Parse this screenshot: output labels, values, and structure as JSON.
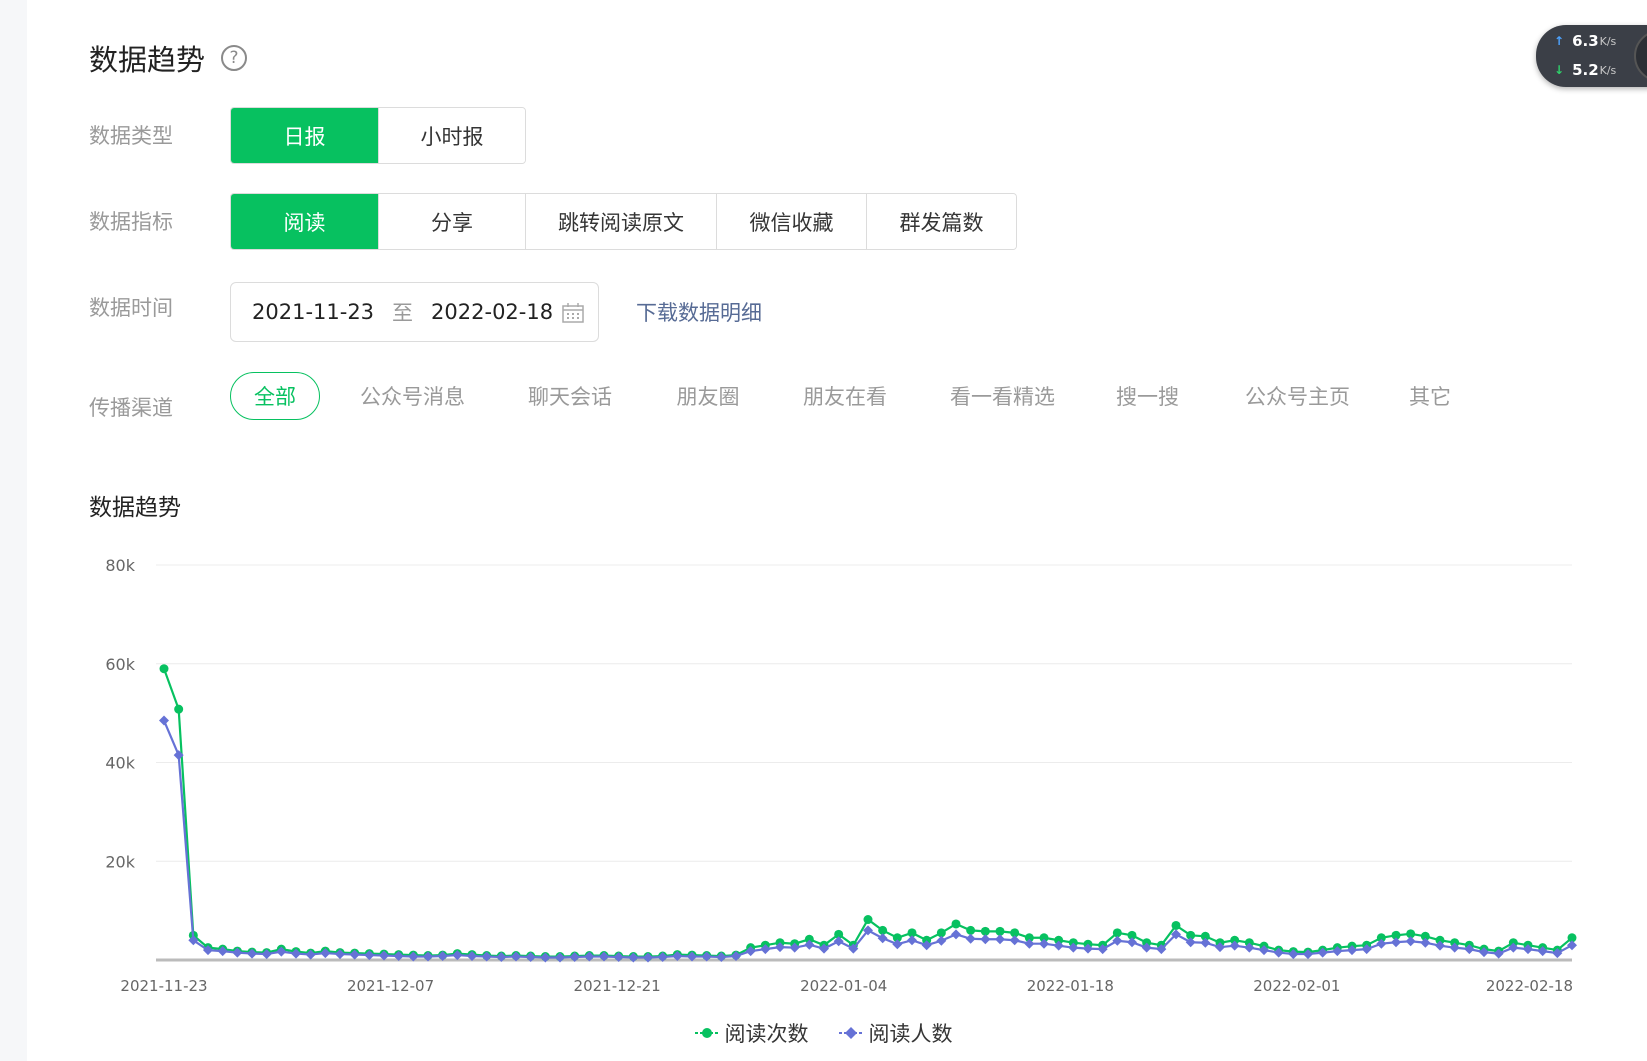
{
  "header": {
    "title": "数据趋势",
    "help_icon": "question-circle-icon"
  },
  "rows": {
    "data_type": {
      "label": "数据类型",
      "options": [
        "日报",
        "小时报"
      ],
      "active": 0
    },
    "data_metric": {
      "label": "数据指标",
      "options": [
        "阅读",
        "分享",
        "跳转阅读原文",
        "微信收藏",
        "群发篇数"
      ],
      "active": 0
    },
    "data_time": {
      "label": "数据时间",
      "start": "2021-11-23",
      "separator": "至",
      "end": "2022-02-18",
      "download": "下载数据明细"
    },
    "channel": {
      "label": "传播渠道",
      "options": [
        "全部",
        "公众号消息",
        "聊天会话",
        "朋友圈",
        "朋友在看",
        "看一看精选",
        "搜一搜",
        "公众号主页",
        "其它"
      ],
      "active": 0
    }
  },
  "speed_widget": {
    "up": "6.3",
    "up_unit": "K/s",
    "down": "5.2",
    "down_unit": "K/s",
    "badge": "5"
  },
  "chart_data": {
    "type": "line",
    "title": "数据趋势",
    "xlabel": "",
    "ylabel": "",
    "ylim": [
      0,
      80000
    ],
    "y_ticks": [
      "80k",
      "60k",
      "40k",
      "20k"
    ],
    "x_tick_labels": [
      "2021-11-23",
      "2021-12-07",
      "2021-12-21",
      "2022-01-04",
      "2022-01-18",
      "2022-02-01",
      "2022-02-18"
    ],
    "x_start": "2021-11-23",
    "x_end": "2022-02-18",
    "colors": {
      "reads": "#07c160",
      "readers": "#6672d6"
    },
    "series": [
      {
        "name": "阅读次数",
        "values": [
          59000,
          50800,
          5000,
          2500,
          2200,
          1800,
          1600,
          1500,
          2200,
          1700,
          1400,
          1800,
          1500,
          1400,
          1300,
          1200,
          1100,
          1000,
          900,
          1000,
          1300,
          1100,
          900,
          800,
          900,
          800,
          700,
          700,
          800,
          900,
          900,
          800,
          700,
          700,
          800,
          1100,
          1000,
          900,
          800,
          1000,
          2500,
          3000,
          3500,
          3300,
          4200,
          3000,
          5200,
          3000,
          8200,
          6000,
          4500,
          5500,
          4000,
          5500,
          7300,
          6000,
          5800,
          5800,
          5500,
          4500,
          4500,
          4000,
          3500,
          3200,
          3000,
          5500,
          5000,
          3500,
          3000,
          7000,
          5000,
          4800,
          3500,
          4000,
          3500,
          2800,
          2000,
          1700,
          1600,
          2000,
          2500,
          2800,
          3000,
          4500,
          5000,
          5300,
          4800,
          4000,
          3500,
          3000,
          2200,
          1800,
          3500,
          3000,
          2500,
          2000,
          4500
        ]
      },
      {
        "name": "阅读人数",
        "values": [
          48500,
          41500,
          4000,
          2000,
          1800,
          1500,
          1300,
          1200,
          1700,
          1300,
          1100,
          1400,
          1200,
          1100,
          1000,
          900,
          800,
          700,
          700,
          800,
          1000,
          800,
          700,
          600,
          700,
          600,
          500,
          500,
          600,
          700,
          700,
          600,
          500,
          500,
          600,
          800,
          700,
          700,
          600,
          800,
          1800,
          2200,
          2600,
          2500,
          3100,
          2300,
          3800,
          2300,
          6000,
          4400,
          3200,
          4000,
          3000,
          3900,
          5200,
          4300,
          4200,
          4200,
          4000,
          3300,
          3300,
          2900,
          2500,
          2300,
          2200,
          3900,
          3600,
          2500,
          2200,
          5200,
          3600,
          3500,
          2600,
          2900,
          2500,
          2000,
          1500,
          1200,
          1200,
          1500,
          1800,
          2000,
          2200,
          3300,
          3600,
          3800,
          3500,
          2900,
          2500,
          2200,
          1600,
          1300,
          2500,
          2200,
          1800,
          1400,
          3000
        ]
      }
    ],
    "legend": [
      "阅读次数",
      "阅读人数"
    ],
    "grid": true,
    "legend_position": "bottom-center"
  }
}
